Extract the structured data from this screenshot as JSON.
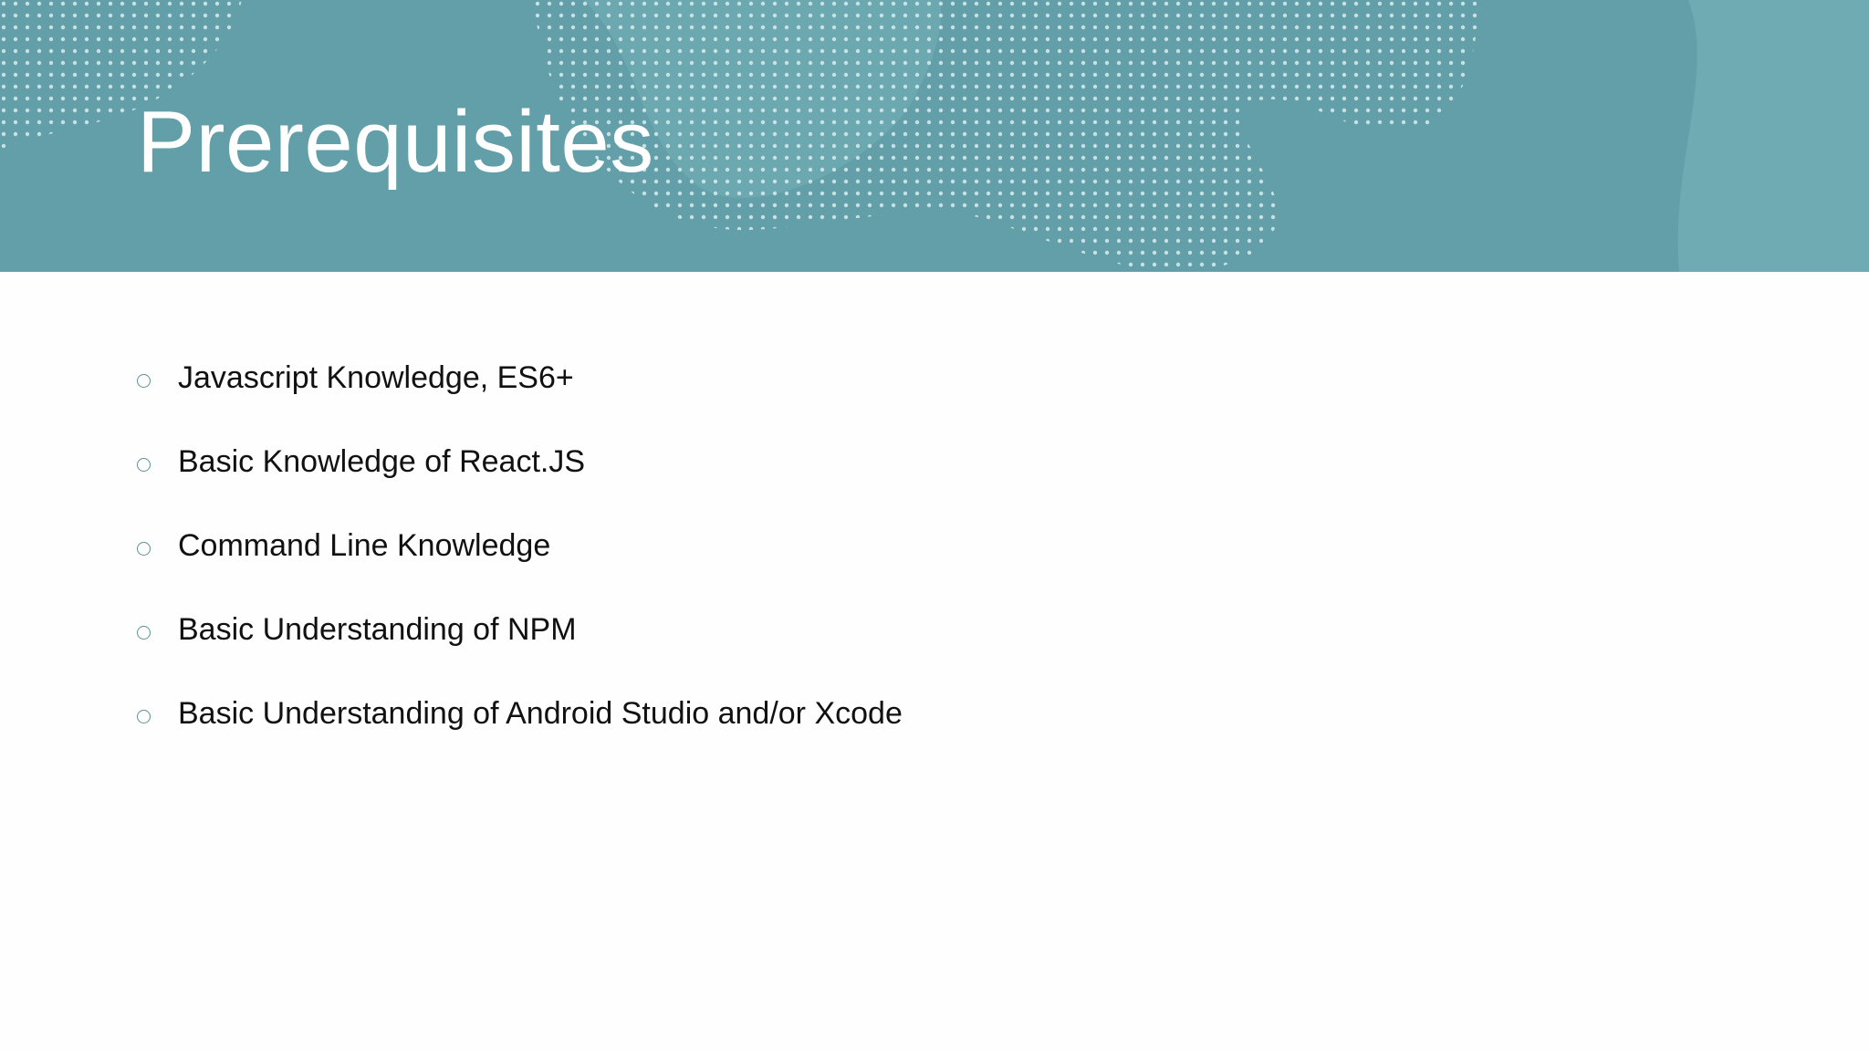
{
  "slide": {
    "title": "Prerequisites",
    "bullets": [
      "Javascript Knowledge, ES6+",
      "Basic Knowledge of React.JS",
      "Command Line Knowledge",
      "Basic Understanding of NPM",
      "Basic Understanding of Android Studio and/or Xcode"
    ],
    "bullet_icon": "hollow-circle-bullet-icon"
  },
  "colors": {
    "header_background": "#629fa8",
    "title_text": "#ffffff",
    "body_text": "#111111",
    "bullet_marker": "#5f8f96"
  }
}
